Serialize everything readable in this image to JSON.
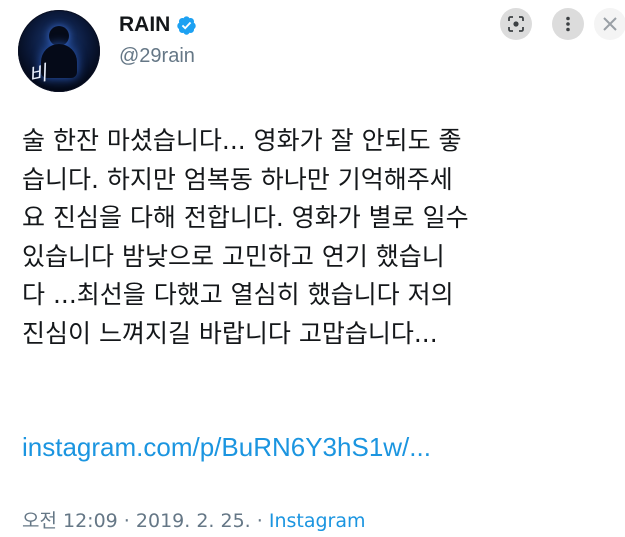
{
  "profile": {
    "display_name": "RAIN",
    "handle": "@29rain",
    "avatar_signature": "비"
  },
  "tweet": {
    "lines": [
      "술 한잔 마셨습니다... 영화가 잘 안되도 좋",
      "습니다. 하지만 엄복동 하나만 기억해주세",
      "요 진심을 다해 전합니다. 영화가 별로 일수",
      "있습니다 밤낮으로 고민하고 연기 했습니",
      "다 ...최선을 다했고 열심히 했습니다 저의",
      "진심이 느껴지길 바랍니다 고맙습니다..."
    ],
    "link": "instagram.com/p/BuRN6Y3hS1w/..."
  },
  "meta": {
    "time": "오전 12:09",
    "separator": " · ",
    "date": "2019. 2. 25.",
    "source": "Instagram"
  },
  "colors": {
    "link": "#1b95e0",
    "muted": "#657786",
    "verified": "#1da1f2"
  },
  "icons": {
    "lens": "lens-icon",
    "more": "more-vertical-icon",
    "close": "close-icon",
    "verified": "verified-badge-icon"
  }
}
